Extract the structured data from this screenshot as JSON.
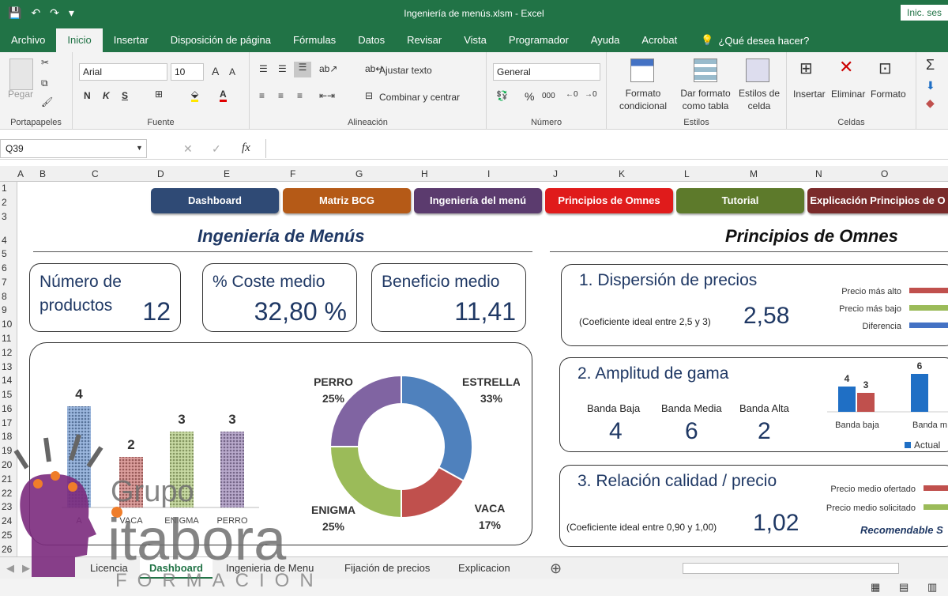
{
  "window": {
    "title": "Ingeniería de menús.xlsm  -  Excel",
    "signin": "Inic. ses"
  },
  "ribbon_tabs": [
    "Archivo",
    "Inicio",
    "Insertar",
    "Disposición de página",
    "Fórmulas",
    "Datos",
    "Revisar",
    "Vista",
    "Programador",
    "Ayuda",
    "Acrobat"
  ],
  "tell_me": "¿Qué desea hacer?",
  "ribbon": {
    "clipboard": {
      "paste": "Pegar",
      "label": "Portapapeles"
    },
    "font": {
      "name": "Arial",
      "size": "10",
      "bold": "N",
      "italic": "K",
      "underline": "S",
      "label": "Fuente"
    },
    "alignment": {
      "wrap": "Ajustar texto",
      "merge": "Combinar y centrar",
      "label": "Alineación"
    },
    "number": {
      "format": "General",
      "percent": "%",
      "thousands": "000",
      "label": "Número"
    },
    "styles": {
      "conditional": "Formato condicional",
      "table": "Dar formato como tabla",
      "cell": "Estilos de celda",
      "label": "Estilos"
    },
    "cells": {
      "insert": "Insertar",
      "delete": "Eliminar",
      "format": "Formato",
      "label": "Celdas"
    }
  },
  "formula_bar": {
    "name_box": "Q39",
    "fx": "fx",
    "content": ""
  },
  "columns": [
    "A",
    "B",
    "C",
    "D",
    "E",
    "F",
    "G",
    "H",
    "I",
    "J",
    "K",
    "L",
    "M",
    "N",
    "O"
  ],
  "rows": [
    "1",
    "2",
    "3",
    "4",
    "5",
    "6",
    "7",
    "8",
    "9",
    "10",
    "11",
    "12",
    "13",
    "14",
    "15",
    "16",
    "17",
    "18",
    "19",
    "20",
    "21",
    "22",
    "23",
    "24",
    "25",
    "26"
  ],
  "nav_buttons": [
    {
      "label": "Dashboard",
      "color": "#2f4a75"
    },
    {
      "label": "Matriz BCG",
      "color": "#b55a17"
    },
    {
      "label": "Ingeniería del menú",
      "color": "#5b3b6e"
    },
    {
      "label": "Principios de Omnes",
      "color": "#e01b1b"
    },
    {
      "label": "Tutorial",
      "color": "#5d7a2b"
    },
    {
      "label": "Explicación Principios de O",
      "color": "#7a2a2a"
    }
  ],
  "left_title": "Ingeniería de Menús",
  "right_title": "Principios de Omnes",
  "kpis": [
    {
      "label": "Número de productos",
      "value": "12"
    },
    {
      "label": "% Coste medio",
      "value": "32,80 %"
    },
    {
      "label": "Beneficio medio",
      "value": "11,41"
    }
  ],
  "chart_data": [
    {
      "type": "bar",
      "categories": [
        "ESTRELLA",
        "VACA",
        "ENIGMA",
        "PERRO"
      ],
      "values": [
        4,
        2,
        3,
        3
      ],
      "colors": [
        "#4a7cc3",
        "#c0504d",
        "#9bbb59",
        "#8064a2"
      ],
      "visible_category_labels": [
        "A",
        "VACA",
        "ENIGMA",
        "PERRO"
      ]
    },
    {
      "type": "pie",
      "labels": [
        "ESTRELLA",
        "VACA",
        "ENIGMA",
        "PERRO"
      ],
      "values": [
        33,
        17,
        25,
        25
      ],
      "value_labels": [
        "33%",
        "17%",
        "25%",
        "25%"
      ],
      "colors": [
        "#4f81bd",
        "#c0504d",
        "#9bbb59",
        "#8064a2"
      ]
    },
    {
      "type": "bar",
      "categories": [
        "Precio más alto",
        "Precio más bajo",
        "Diferencia"
      ],
      "colors": [
        "#c0504d",
        "#9bbb59",
        "#4472c4"
      ]
    },
    {
      "type": "bar",
      "categories": [
        "Banda baja",
        "Banda m"
      ],
      "series": [
        {
          "name": "Actual",
          "values": [
            4,
            6
          ],
          "color": "#1f6fc5"
        },
        {
          "values": [
            3,
            null
          ],
          "color": "#c0504d"
        }
      ]
    },
    {
      "type": "bar",
      "categories": [
        "Precio medio ofertado",
        "Precio medio solicitado"
      ],
      "colors": [
        "#c0504d",
        "#9bbb59"
      ]
    }
  ],
  "omnes": [
    {
      "title": "1. Dispersión de precios",
      "note": "(Coeficiente ideal entre 2,5 y 3)",
      "value": "2,58"
    },
    {
      "title": "2. Amplitud de gama",
      "bands": [
        {
          "label": "Banda Baja",
          "value": "4"
        },
        {
          "label": "Banda Media",
          "value": "6"
        },
        {
          "label": "Banda Alta",
          "value": "2"
        }
      ]
    },
    {
      "title": "3. Relación calidad / precio",
      "note": "(Coeficiente ideal entre 0,90 y 1,00)",
      "value": "1,02",
      "verdict": "Recomendable S"
    }
  ],
  "sheet_tabs": [
    "Licencia",
    "Dashboard",
    "Ingenieria de Menu",
    "Fijación de precios",
    "Explicacion"
  ],
  "watermark": {
    "line1": "Grupo",
    "line2": "itabora",
    "line3": "FORMACION"
  }
}
